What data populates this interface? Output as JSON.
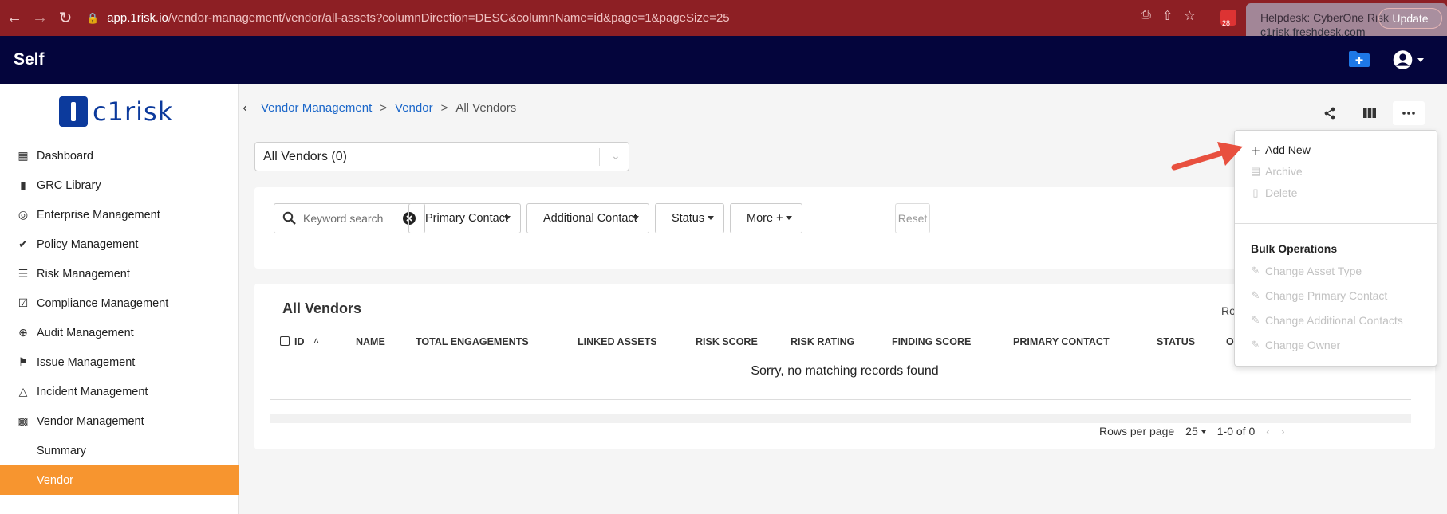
{
  "browser": {
    "url_host": "app.1risk.io",
    "url_path": "/vendor-management/vendor/all-assets?columnDirection=DESC&columnName=id&page=1&pageSize=25",
    "tooltip_line1": "Helpdesk: CyberOne Risk",
    "tooltip_line2": "c1risk.freshdesk.com",
    "update_label": "Update",
    "ext_badge": "28"
  },
  "header": {
    "title": "Self"
  },
  "logo": {
    "text": "c1risk"
  },
  "sidebar": {
    "items": [
      {
        "label": "Dashboard",
        "icon": "dashboard-icon"
      },
      {
        "label": "GRC Library",
        "icon": "book-icon"
      },
      {
        "label": "Enterprise Management",
        "icon": "globe-icon"
      },
      {
        "label": "Policy Management",
        "icon": "double-check-icon"
      },
      {
        "label": "Risk Management",
        "icon": "list-icon"
      },
      {
        "label": "Compliance Management",
        "icon": "clipboard-check-icon"
      },
      {
        "label": "Audit Management",
        "icon": "crosshair-icon"
      },
      {
        "label": "Issue Management",
        "icon": "flag-icon"
      },
      {
        "label": "Incident Management",
        "icon": "fire-icon"
      },
      {
        "label": "Vendor Management",
        "icon": "grid-icon"
      }
    ],
    "sub_items": [
      {
        "label": "Summary"
      },
      {
        "label": "Vendor",
        "active": true
      }
    ],
    "active_color": "#f7952f"
  },
  "breadcrumb": {
    "items": [
      "Vendor Management",
      "Vendor",
      "All Vendors"
    ],
    "separator": ">"
  },
  "vendor_select": {
    "value": "All Vendors (0)"
  },
  "filters": {
    "search_placeholder": "Keyword search",
    "primary_contact": "Primary Contact",
    "additional_contact": "Additional Contact",
    "status": "Status",
    "more": "More +",
    "reset": "Reset"
  },
  "table": {
    "title": "All Vendors",
    "rows_trunc": "Ro",
    "columns": [
      "ID",
      "NAME",
      "TOTAL ENGAGEMENTS",
      "LINKED ASSETS",
      "RISK SCORE",
      "RISK RATING",
      "FINDING SCORE",
      "PRIMARY CONTACT",
      "STATUS",
      "OW"
    ],
    "empty_message": "Sorry, no matching records found",
    "rows_per_page_label": "Rows per page",
    "rows_per_page_value": "25",
    "range": "1-0 of 0"
  },
  "menu": {
    "actions": [
      {
        "label": "Add New",
        "icon": "plus-icon",
        "enabled": true
      },
      {
        "label": "Archive",
        "icon": "archive-icon",
        "enabled": false
      },
      {
        "label": "Delete",
        "icon": "trash-icon",
        "enabled": false
      }
    ],
    "bulk_heading": "Bulk Operations",
    "bulk_items": [
      {
        "label": "Change Asset Type",
        "icon": "edit-icon"
      },
      {
        "label": "Change Primary Contact",
        "icon": "edit-icon"
      },
      {
        "label": "Change Additional Contacts",
        "icon": "edit-icon"
      },
      {
        "label": "Change Owner",
        "icon": "edit-icon"
      }
    ]
  },
  "colors": {
    "browser_bar": "#8d1f24",
    "app_header": "#04053c",
    "link": "#1a66c9",
    "arrow": "#e8503f"
  }
}
